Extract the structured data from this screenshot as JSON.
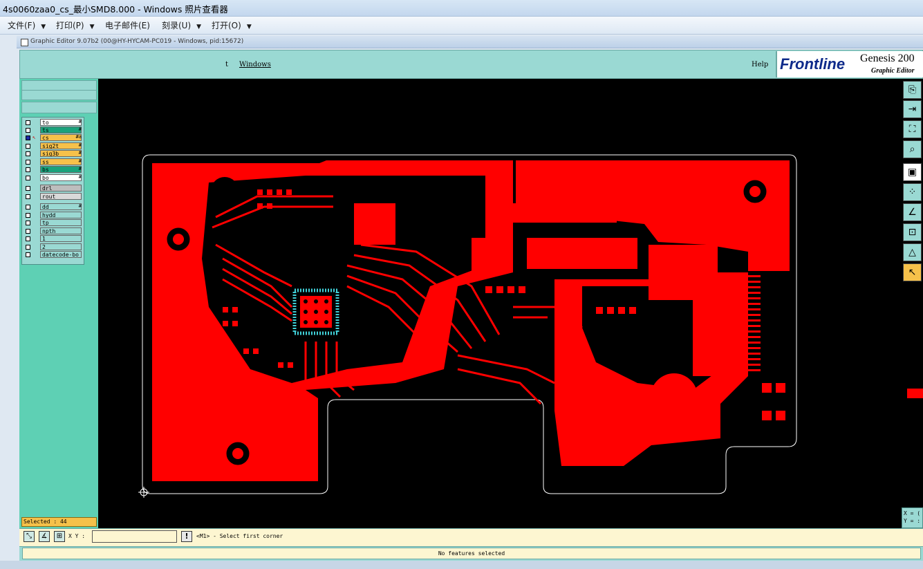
{
  "window": {
    "title": "4s0060zaa0_cs_最小SMD8.000 - Windows 照片查看器"
  },
  "viewer_menu": [
    {
      "label": "文件(F)",
      "arrow": "▼"
    },
    {
      "label": "打印(P)",
      "arrow": "▼"
    },
    {
      "label": "电子邮件(E)",
      "arrow": ""
    },
    {
      "label": "刻录(U)",
      "arrow": "▼"
    },
    {
      "label": "打开(O)",
      "arrow": "▼"
    }
  ],
  "app": {
    "title": "Graphic Editor 9.07b2 (00@HY-HYCAM-PC019 - Windows, pid:15672)",
    "menu": {
      "partial": "t",
      "windows": "Windows",
      "help": "Help"
    },
    "logo": {
      "brand": "Frontline",
      "product": "Genesis 200",
      "subtitle": "Graphic Editor"
    }
  },
  "layers": [
    {
      "name": "to",
      "color": "#ffffff",
      "flags": "#"
    },
    {
      "name": "ts",
      "color": "#1aa27c",
      "flags": "#"
    },
    {
      "name": "cs",
      "color": "#f6c14a",
      "flags": "#a",
      "active": true
    },
    {
      "name": "sig2t",
      "color": "#f6c14a",
      "flags": "#"
    },
    {
      "name": "sig3b",
      "color": "#f6c14a",
      "flags": "#"
    },
    {
      "name": "ss",
      "color": "#f6c14a",
      "flags": "#"
    },
    {
      "name": "bs",
      "color": "#1aa27c",
      "flags": "#"
    },
    {
      "name": "bo",
      "color": "#ffffff",
      "flags": "#"
    },
    {
      "name": "drl",
      "color": "#bdbdbd",
      "flags": ""
    },
    {
      "name": "rout",
      "color": "#d9d9d9",
      "flags": ""
    },
    {
      "name": "dd",
      "color": "#9ad9d3",
      "flags": "#"
    },
    {
      "name": "hydd",
      "color": "#9ad9d3",
      "flags": ""
    },
    {
      "name": "tp",
      "color": "#9ad9d3",
      "flags": ""
    },
    {
      "name": "npth",
      "color": "#9ad9d3",
      "flags": ""
    },
    {
      "name": "1",
      "color": "#9ad9d3",
      "flags": ""
    },
    {
      "name": "2",
      "color": "#9ad9d3",
      "flags": ""
    },
    {
      "name": "datecode-bo",
      "color": "#9ad9d3",
      "flags": ""
    }
  ],
  "selected": "Selected : 44",
  "command": {
    "xy_label": "X Y :",
    "xy_value": "",
    "warn": "!",
    "prompt": "<M1> - Select first corner"
  },
  "status": "No features selected",
  "coords": {
    "x": "X = (",
    "y": "Y = :"
  },
  "toolbar_icons": [
    "page-icon",
    "arrow-in-icon",
    "fit-icon",
    "zoom-icon",
    "frame-icon",
    "snap-icon",
    "measure-icon",
    "select-icon",
    "triangle-icon",
    "cursor-icon"
  ],
  "colors": {
    "board": "#ff0000",
    "board_outline": "#ffffff",
    "component": "#40d0d8",
    "panel": "#5ed0b4",
    "panel_light": "#9ad9d3",
    "highlight": "#f6c14a"
  }
}
